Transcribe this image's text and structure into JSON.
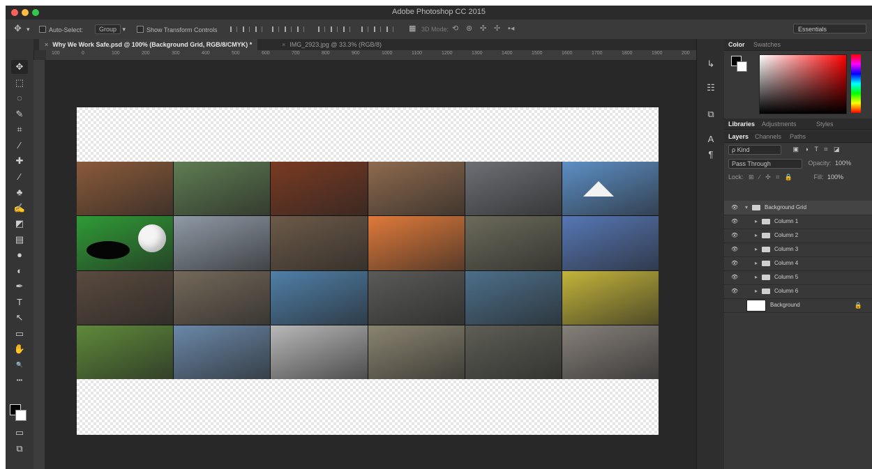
{
  "app": {
    "title": "Adobe Photoshop CC 2015"
  },
  "options_bar": {
    "auto_select": "Auto-Select:",
    "group": "Group",
    "show_transform": "Show Transform Controls",
    "mode_3d": "3D Mode:",
    "workspace": "Essentials"
  },
  "document_tabs": [
    {
      "label": "Why We Work Safe.psd @ 100% (Background Grid, RGB/8/CMYK) *"
    },
    {
      "label": "IMG_2923.jpg @ 33.3% (RGB/8)"
    }
  ],
  "ruler": {
    "ticks": [
      "100",
      "0",
      "100",
      "200",
      "300",
      "400",
      "500",
      "600",
      "700",
      "800",
      "900",
      "1000",
      "1100",
      "1200",
      "1300",
      "1400",
      "1500",
      "1600",
      "1700",
      "1800",
      "1900",
      "200"
    ]
  },
  "tools": [
    "move-icon",
    "marquee-icon",
    "lasso-icon",
    "quick-select-icon",
    "crop-icon",
    "eyedropper-icon",
    "healing-icon",
    "brush-icon",
    "stamp-icon",
    "history-brush-icon",
    "eraser-icon",
    "gradient-icon",
    "blur-icon",
    "dodge-icon",
    "pen-icon",
    "type-icon",
    "path-select-icon",
    "rectangle-icon",
    "hand-icon",
    "zoom-icon",
    "more-icon"
  ],
  "tool_glyphs": [
    "✥",
    "⬚",
    "◌",
    "✎",
    "⌗",
    "⁄",
    "✚",
    "∕",
    "♣",
    "✍",
    "◩",
    "▤",
    "●",
    "◐",
    "✒",
    "T",
    "↖",
    "▭",
    "✋",
    "🔍",
    "•••"
  ],
  "photo_grid": {
    "cells": [
      "#8a5a3a",
      "#5f7d52",
      "#7a3a22",
      "#8e6a4e",
      "#6d6f74",
      "#5d8fc6",
      "#2f9b35",
      "#8f9aa6",
      "#6c5a48",
      "#e07a3a",
      "#6b6a5a",
      "#5677b5",
      "#5a4a3e",
      "#74695a",
      "#4f7fa8",
      "#5a5a58",
      "#4c6f8a",
      "#c3b43a",
      "#5e8a3a",
      "#6a88a8",
      "#b8b8b8",
      "#8a8470",
      "#5e5e56",
      "#86807a"
    ]
  },
  "panel": {
    "color_tabs": [
      "Color",
      "Swatches"
    ],
    "lib_tabs": [
      "Libraries",
      "Adjustments",
      "Styles"
    ],
    "layer_tabs": [
      "Layers",
      "Channels",
      "Paths"
    ],
    "kind": "ρ Kind",
    "blend_mode": "Pass Through",
    "opacity_label": "Opacity:",
    "opacity_value": "100%",
    "lock_label": "Lock:",
    "fill_label": "Fill:",
    "fill_value": "100%",
    "layers": [
      {
        "name": "Background Grid",
        "type": "group-open"
      },
      {
        "name": "Column 1",
        "type": "group"
      },
      {
        "name": "Column 2",
        "type": "group"
      },
      {
        "name": "Column 3",
        "type": "group"
      },
      {
        "name": "Column 4",
        "type": "group"
      },
      {
        "name": "Column 5",
        "type": "group"
      },
      {
        "name": "Column 6",
        "type": "group"
      },
      {
        "name": "Background",
        "type": "image"
      }
    ]
  }
}
